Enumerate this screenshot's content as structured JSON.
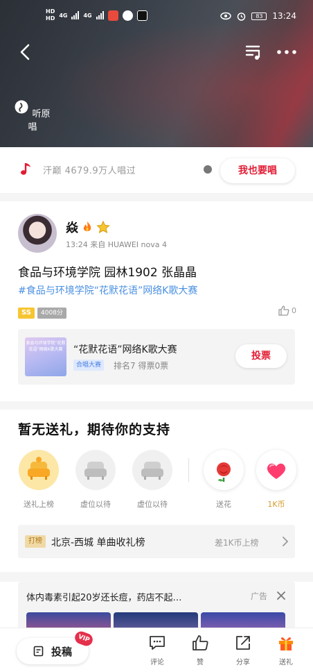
{
  "status_bar": {
    "hd1": "HD",
    "hd2": "HD",
    "net1": "4G",
    "net2": "4G",
    "battery": "83",
    "time": "13:24"
  },
  "header": {
    "original_label": "听原唱"
  },
  "sing_row": {
    "count_text": "汗巅 4679.9万人唱过",
    "button_label": "我也要唱"
  },
  "post": {
    "username": "焱",
    "meta": "13:24 来自 HUAWEI nova 4",
    "title": "食品与环境学院 园林1902 张晶晶",
    "hashtag": "#食品与环境学院“花默花语”网络K歌大赛",
    "grade": "SS",
    "score": "4008分",
    "likes": "0"
  },
  "contest": {
    "thumb_text": "食品与环境学院“花默花语”网络K歌大赛",
    "title": "“花默花语”网络K歌大赛",
    "tag": "合唱大赛",
    "rank": "排名7 得票0票",
    "vote_label": "投票"
  },
  "gifts": {
    "title": "暂无送礼，期待你的支持",
    "slots": [
      {
        "label": "送礼上榜"
      },
      {
        "label": "虚位以待"
      },
      {
        "label": "虚位以待"
      }
    ],
    "send_flower": "送花",
    "coin_label": "1K币"
  },
  "rank_row": {
    "tag": "打榜",
    "text": "北京-西城 单曲收礼榜",
    "gap": "差1K币上榜"
  },
  "ad": {
    "text": "体内毒素引起20岁还长痘，药店不起…",
    "label": "广告"
  },
  "bottom_bar": {
    "post_label": "投稿",
    "vip": "VIP",
    "tabs": [
      {
        "label": "评论"
      },
      {
        "label": "赞"
      },
      {
        "label": "分享"
      },
      {
        "label": "送礼"
      }
    ]
  },
  "colors": {
    "accent": "#e21b33",
    "link": "#4a90e2",
    "gold": "#f7c531"
  }
}
